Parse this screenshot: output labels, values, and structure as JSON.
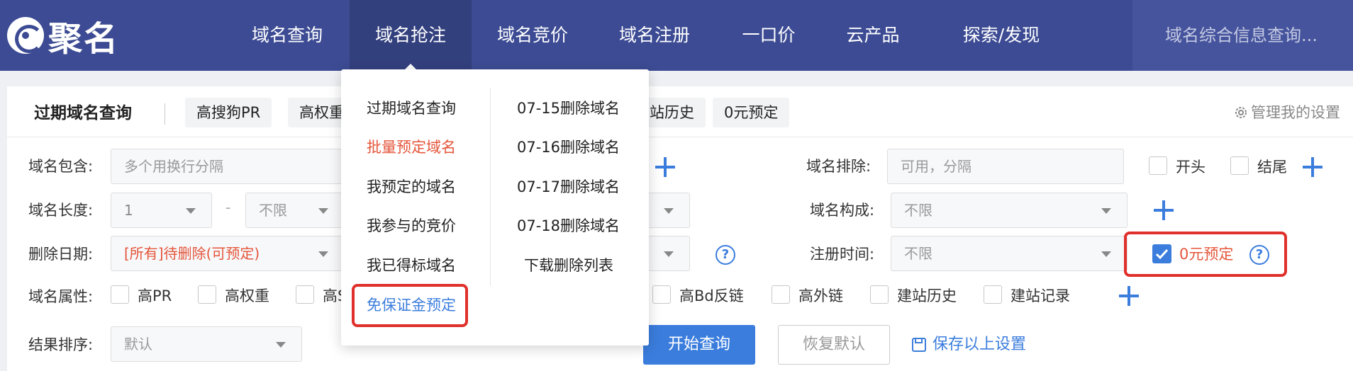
{
  "brand": {
    "name": "聚名"
  },
  "nav": {
    "items": [
      "域名查询",
      "域名抢注",
      "域名竞价",
      "域名注册",
      "一口价",
      "云产品",
      "探索/发现"
    ],
    "search_placeholder": "域名综合信息查询..."
  },
  "tabs": {
    "title": "过期域名查询",
    "chips": [
      "高搜狗PR",
      "高权重",
      "站历史",
      "0元预定"
    ],
    "settings": "管理我的设置"
  },
  "filters": {
    "contains_label": "域名包含:",
    "contains_placeholder": "多个用换行分隔",
    "exclude_label": "域名排除:",
    "exclude_placeholder": "可用，分隔",
    "start_label": "开头",
    "end_label": "结尾",
    "length_label": "域名长度:",
    "length_min": "1",
    "length_dash": "-",
    "length_max": "不限",
    "compose_label": "域名构成:",
    "compose_value": "不限",
    "delete_date_label": "删除日期:",
    "delete_date_value": "[所有]待删除(可预定)",
    "reg_time_label": "注册时间:",
    "reg_time_value": "不限",
    "zero_reserve_label": "0元预定",
    "help_glyph": "?",
    "attr_label": "域名属性:",
    "attrs_left": [
      "高PR",
      "高权重",
      "高S"
    ],
    "attrs_right": [
      "高Bd反链",
      "高外链",
      "建站历史",
      "建站记录"
    ],
    "sort_label": "结果排序:",
    "sort_value": "默认"
  },
  "buttons": {
    "search": "开始查询",
    "reset": "恢复默认",
    "save": "保存以上设置"
  },
  "dropdown": {
    "left": [
      "过期域名查询",
      "批量预定域名",
      "我预定的域名",
      "我参与的竞价",
      "我已得标域名",
      "免保证金预定"
    ],
    "right": [
      "07-15删除域名",
      "07-16删除域名",
      "07-17删除域名",
      "07-18删除域名",
      "下载删除列表"
    ]
  },
  "colors": {
    "nav": "#3c4b93",
    "accent": "#3b7ddd",
    "hot": "#e4553a",
    "highlight": "#e0302b"
  }
}
